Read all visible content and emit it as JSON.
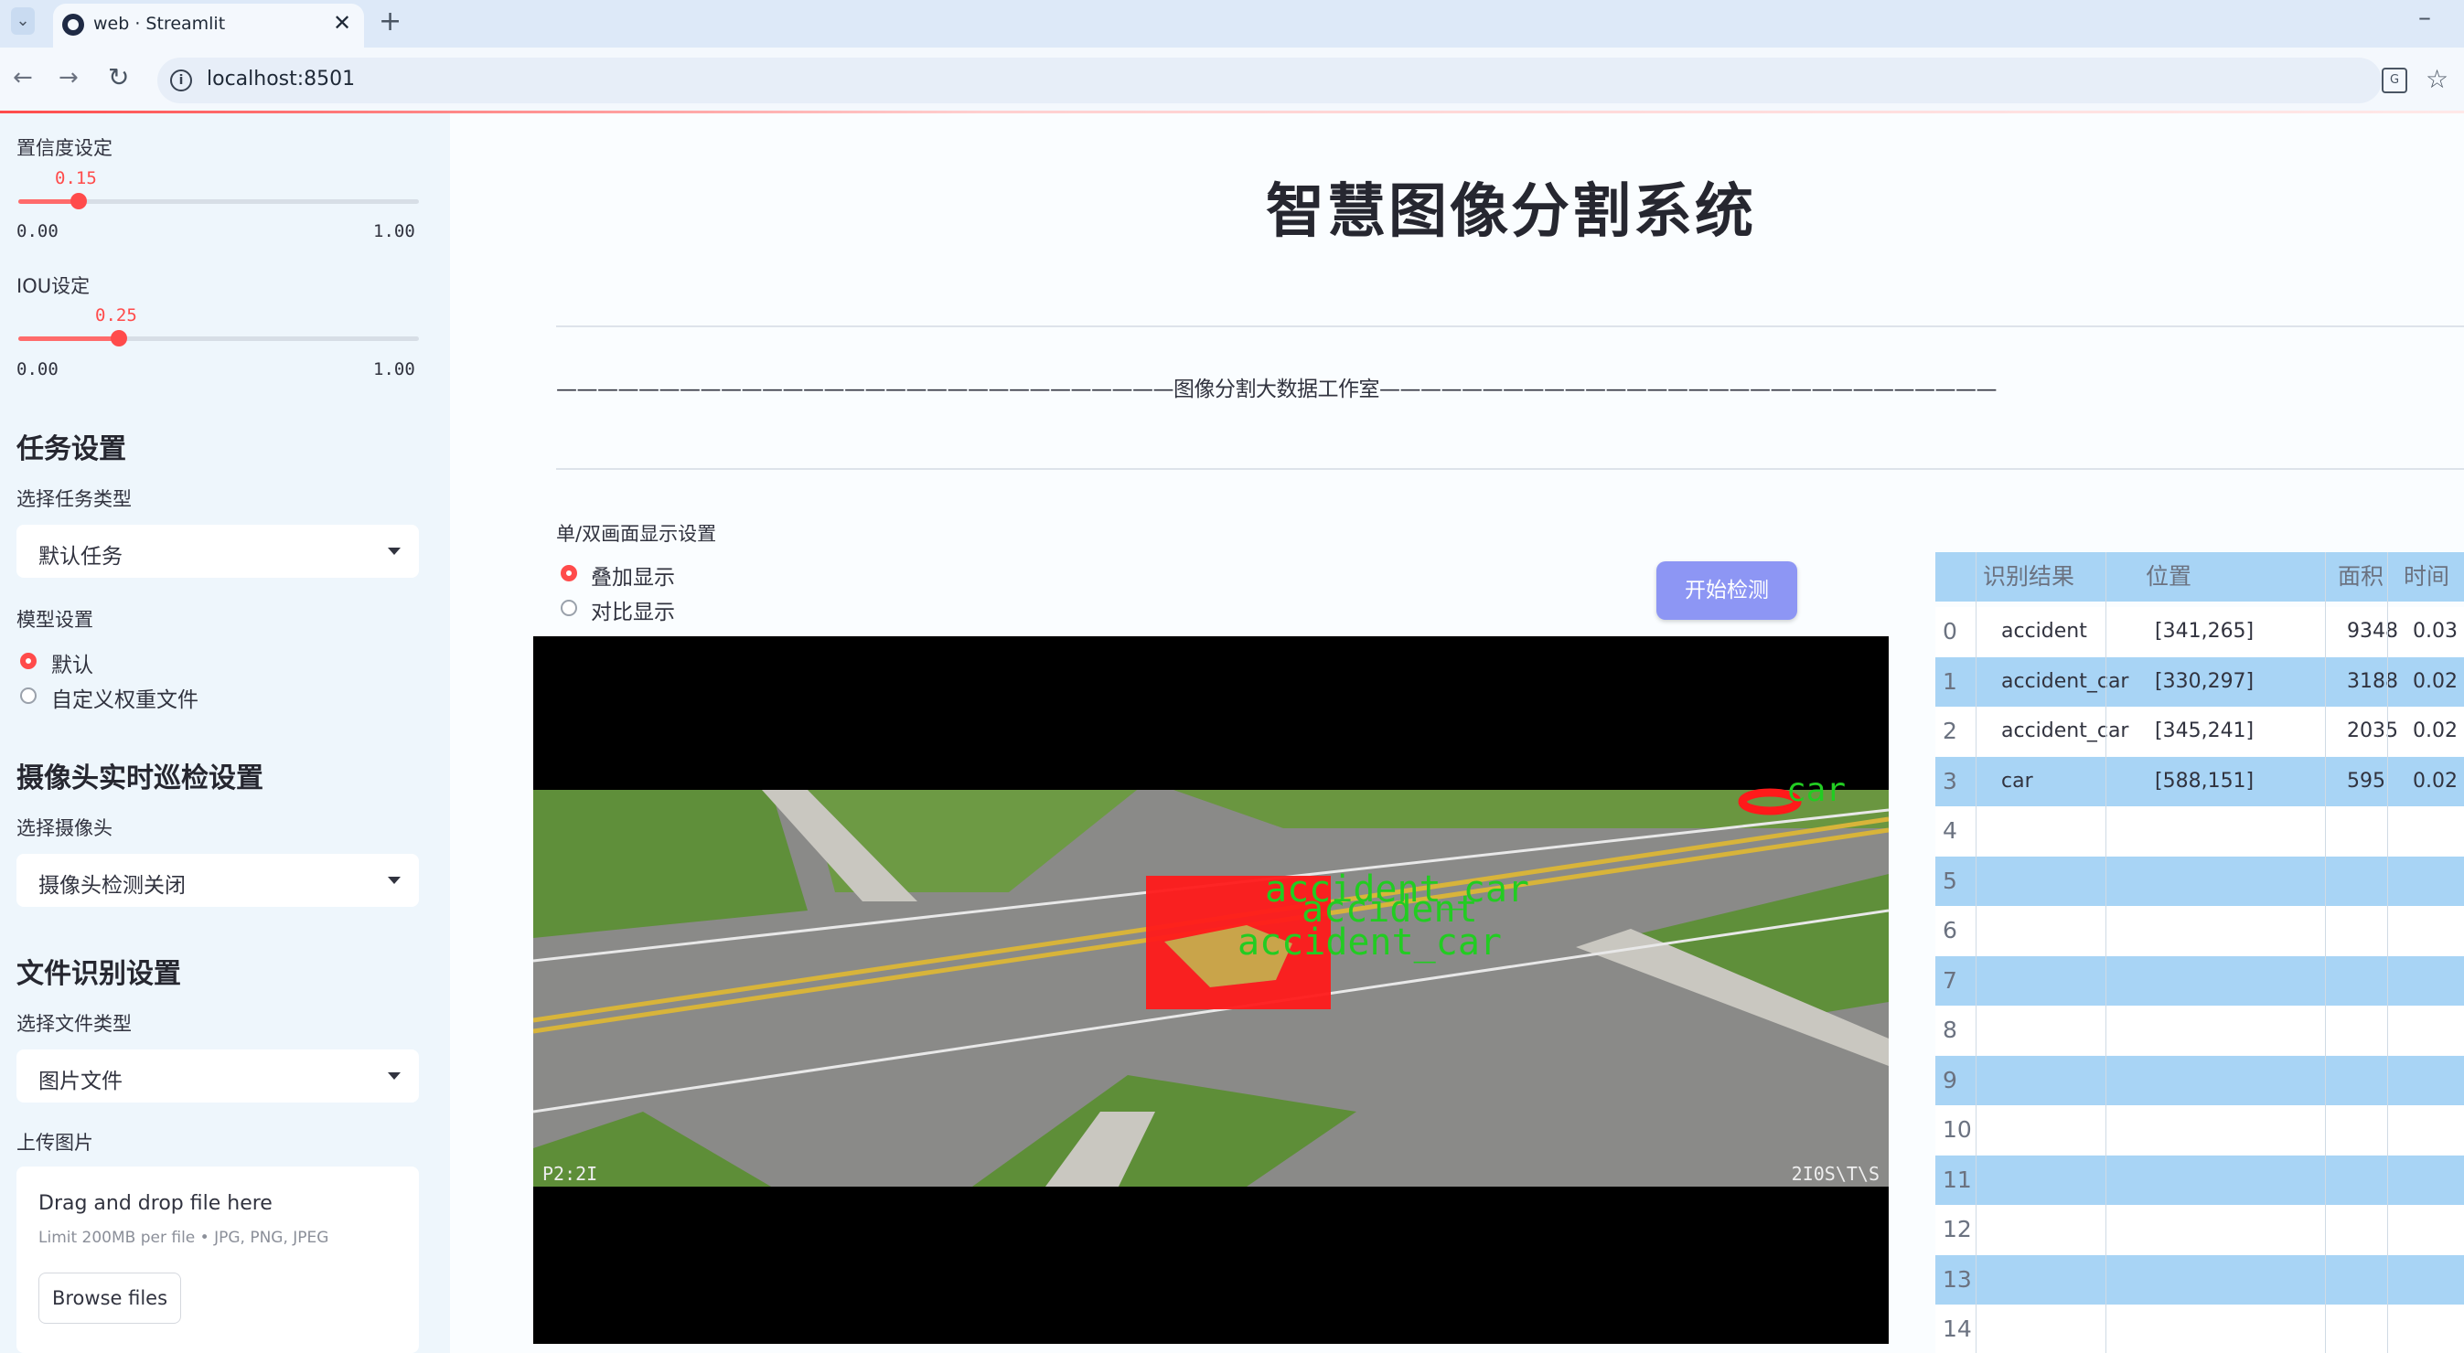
{
  "browser": {
    "tab_title": "web · Streamlit",
    "url": "localhost:8501",
    "icons": [
      "tab-dropdown-icon",
      "streamlit-logo-icon",
      "close-tab-icon",
      "new-tab-icon",
      "minimize-icon",
      "back-icon",
      "forward-icon",
      "reload-icon",
      "site-info-icon",
      "translate-icon",
      "bookmark-star-icon"
    ]
  },
  "sidebar": {
    "confidence": {
      "label": "置信度设定",
      "value": "0.15",
      "min": "0.00",
      "max": "1.00",
      "fraction": 0.15
    },
    "iou": {
      "label": "IOU设定",
      "value": "0.25",
      "min": "0.00",
      "max": "1.00",
      "fraction": 0.25
    },
    "task": {
      "header": "任务设置",
      "label": "选择任务类型",
      "selected": "默认任务"
    },
    "model": {
      "label": "模型设置",
      "options": [
        "默认",
        "自定义权重文件"
      ],
      "selected_index": 0
    },
    "camera": {
      "header": "摄像头实时巡检设置",
      "label": "选择摄像头",
      "selected": "摄像头检测关闭"
    },
    "file": {
      "header": "文件识别设置",
      "label": "选择文件类型",
      "selected": "图片文件"
    },
    "upload": {
      "label": "上传图片",
      "drop_text": "Drag and drop file here",
      "limit_text": "Limit 200MB per file • JPG, PNG, JPEG",
      "browse_label": "Browse files"
    }
  },
  "main": {
    "title": "智慧图像分割系统",
    "banner": "——————————————————————————————图像分割大数据工作室——————————————————————————————",
    "display": {
      "label": "单/双画面显示设置",
      "options": [
        "叠加显示",
        "对比显示"
      ],
      "selected_index": 0
    },
    "start_button": "开始检测",
    "overlay": {
      "detections": [
        "accident_car",
        "accident",
        "accident_car",
        "car"
      ],
      "osd_left": "P2:2I",
      "osd_right": "2I0S\\T\\S",
      "colors": {
        "mask": "#ff1a1a",
        "label": "#22cc22"
      }
    },
    "table": {
      "columns": [
        "",
        "识别结果",
        "位置",
        "面积",
        "时间"
      ],
      "rows": [
        {
          "idx": "0",
          "result": "accident",
          "position": "[341,265]",
          "area": "9348",
          "time": "0.03"
        },
        {
          "idx": "1",
          "result": "accident_car",
          "position": "[330,297]",
          "area": "3188",
          "time": "0.02"
        },
        {
          "idx": "2",
          "result": "accident_car",
          "position": "[345,241]",
          "area": "2035",
          "time": "0.02"
        },
        {
          "idx": "3",
          "result": "car",
          "position": "[588,151]",
          "area": "595",
          "time": "0.02"
        },
        {
          "idx": "4",
          "result": "",
          "position": "",
          "area": "",
          "time": ""
        },
        {
          "idx": "5",
          "result": "",
          "position": "",
          "area": "",
          "time": ""
        },
        {
          "idx": "6",
          "result": "",
          "position": "",
          "area": "",
          "time": ""
        },
        {
          "idx": "7",
          "result": "",
          "position": "",
          "area": "",
          "time": ""
        },
        {
          "idx": "8",
          "result": "",
          "position": "",
          "area": "",
          "time": ""
        },
        {
          "idx": "9",
          "result": "",
          "position": "",
          "area": "",
          "time": ""
        },
        {
          "idx": "10",
          "result": "",
          "position": "",
          "area": "",
          "time": ""
        },
        {
          "idx": "11",
          "result": "",
          "position": "",
          "area": "",
          "time": ""
        },
        {
          "idx": "12",
          "result": "",
          "position": "",
          "area": "",
          "time": ""
        },
        {
          "idx": "13",
          "result": "",
          "position": "",
          "area": "",
          "time": ""
        },
        {
          "idx": "14",
          "result": "",
          "position": "",
          "area": "",
          "time": ""
        }
      ],
      "colors": {
        "header": "#a8d4f5",
        "stripe": "#a8d4f5",
        "plain": "#ffffff"
      }
    }
  },
  "colors": {
    "accent": "#ff4b4b",
    "button": "#8d96f4",
    "sidebar": "#eef6fc"
  }
}
